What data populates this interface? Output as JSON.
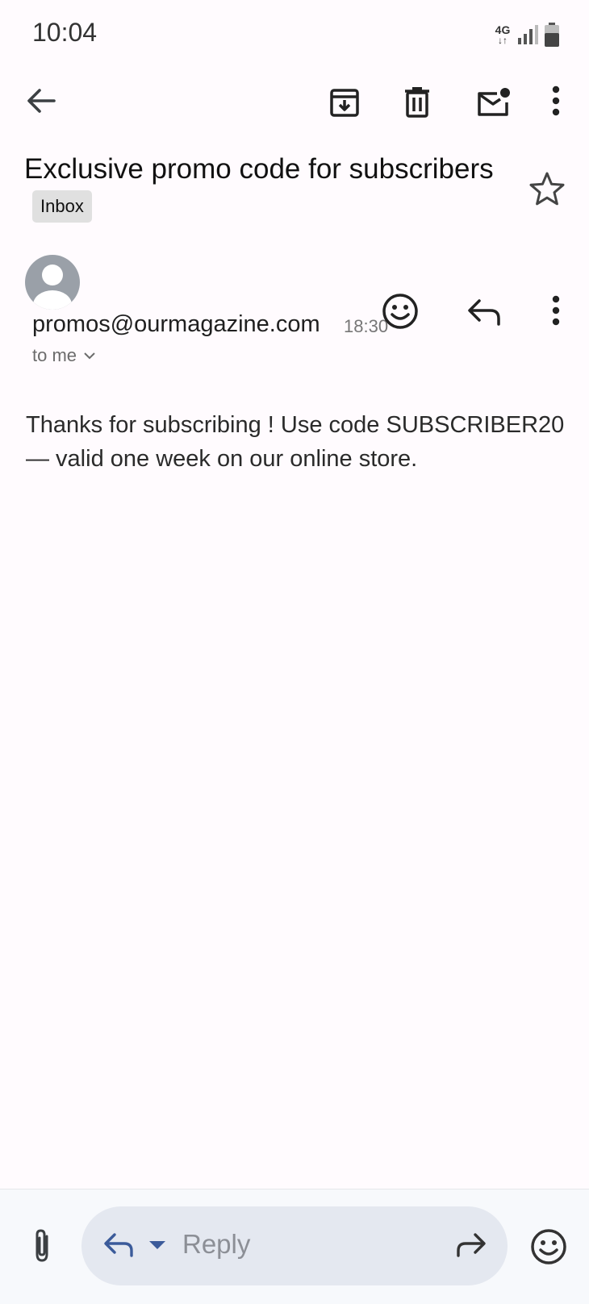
{
  "status_bar": {
    "time": "10:04",
    "network": "4G"
  },
  "toolbar": {
    "icons": [
      "back-arrow-icon",
      "archive-icon",
      "delete-icon",
      "mark-unread-icon",
      "more-vert-icon"
    ]
  },
  "email": {
    "subject": "Exclusive promo code for subscribers",
    "label": "Inbox",
    "sender": "promos@ourmagazine.com",
    "time": "18:30",
    "recipient": "to me",
    "body": "Thanks for subscribing ! Use code SUBSCRIBER20 — valid one week on our online store."
  },
  "reply_bar": {
    "placeholder": "Reply"
  },
  "colors": {
    "background": "#fffbfe",
    "icon": "#3c4043",
    "reply_pill": "#e4e8f0",
    "reply_accent": "#3b5b9a"
  }
}
